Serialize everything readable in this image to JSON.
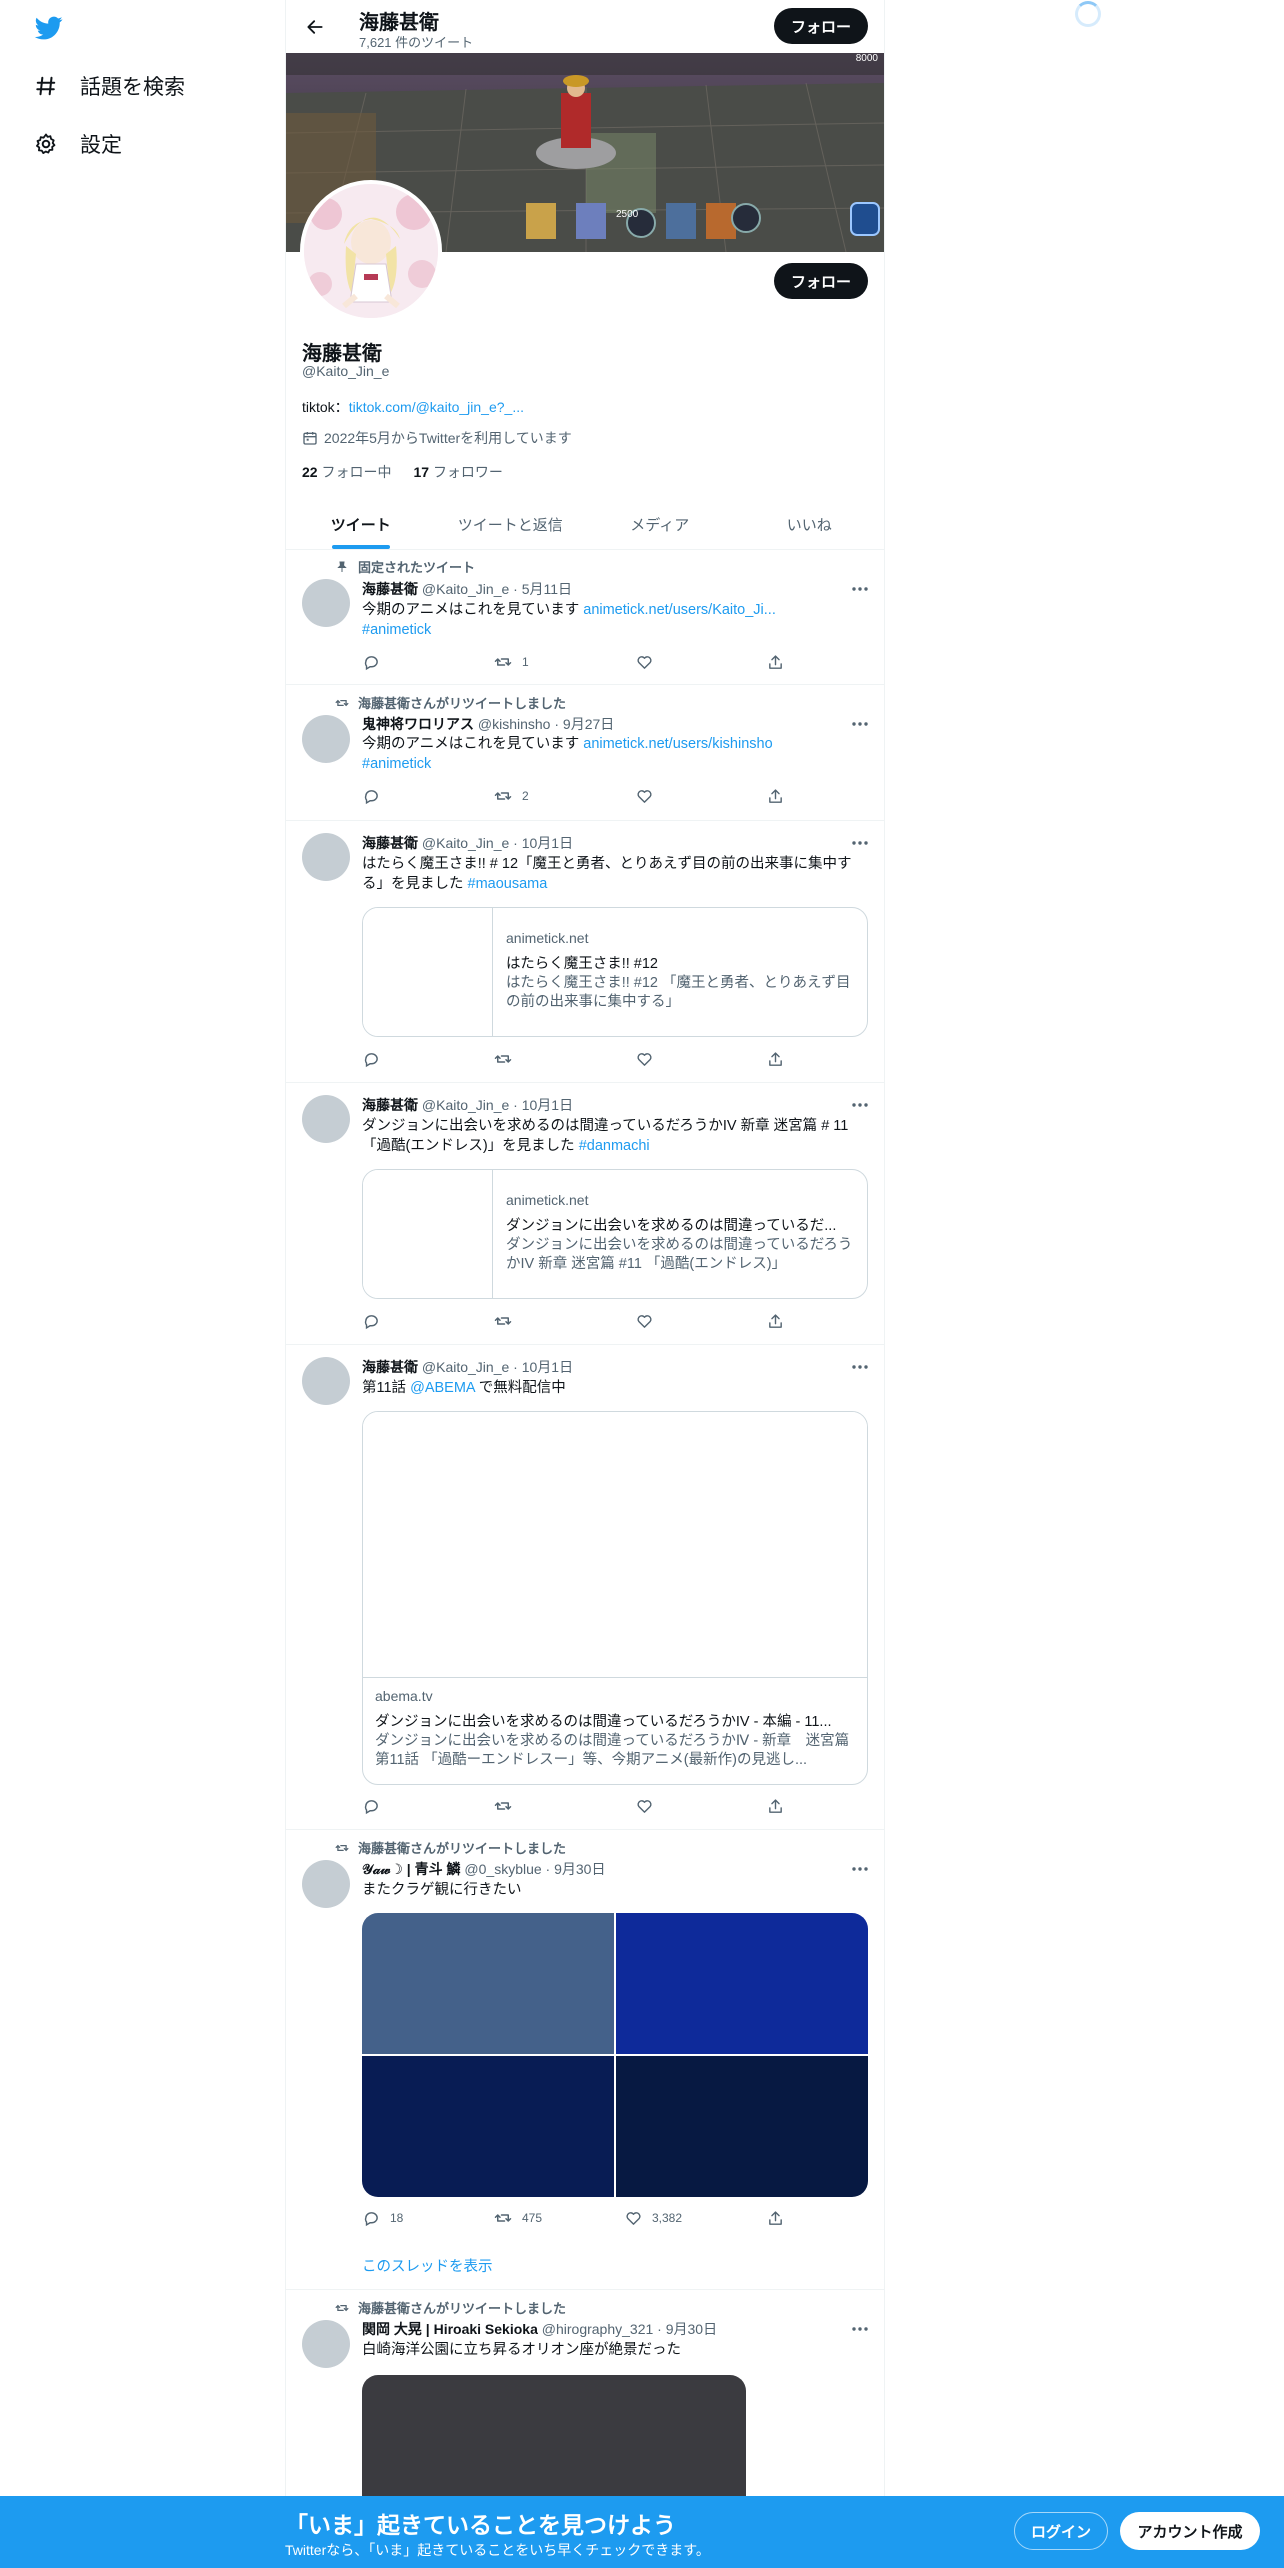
{
  "nav": {
    "explore_label": "話題を検索",
    "settings_label": "設定"
  },
  "header": {
    "name": "海藤甚衛",
    "tweet_count": "7,621 件のツイート",
    "follow_label": "フォロー"
  },
  "banner": {
    "caption": "2500",
    "corner_badge": "8000"
  },
  "profile": {
    "name": "海藤甚衛",
    "handle": "@Kaito_Jin_e",
    "bio_prefix": "tiktok：",
    "bio_link": "tiktok.com/@kaito_jin_e?_...",
    "joined": "2022年5月からTwitterを利用しています",
    "following_count": "22",
    "following_label": "フォロー中",
    "followers_count": "17",
    "followers_label": "フォロワー",
    "follow_label": "フォロー"
  },
  "tabs": [
    "ツイート",
    "ツイートと返信",
    "メディア",
    "いいね"
  ],
  "tweets": [
    {
      "social": "固定されたツイート",
      "name": "海藤甚衛",
      "meta": "@Kaito_Jin_e · 5月11日",
      "text": "今期のアニメはこれを見ています ",
      "link": "animetick.net/users/Kaito_Ji...",
      "hashtag": "#animetick",
      "retweets": "1"
    },
    {
      "social": "海藤甚衛さんがリツイートしました",
      "name": "鬼神将ワロリアス",
      "meta": "@kishinsho · 9月27日",
      "text": "今期のアニメはこれを見ています ",
      "link": "animetick.net/users/kishinsho",
      "hashtag": "#animetick",
      "retweets": "2"
    },
    {
      "name": "海藤甚衛",
      "meta": "@Kaito_Jin_e · 10月1日",
      "text": "はたらく魔王さま!! # 12「魔王と勇者、とりあえず目の前の出来事に集中する」を見ました ",
      "hashtag": "#maousama",
      "card_domain": "animetick.net",
      "card_title": "はたらく魔王さま!! #12",
      "card_desc": "はたらく魔王さま!! #12 「魔王と勇者、とりあえず目の前の出来事に集中する」"
    },
    {
      "name": "海藤甚衛",
      "meta": "@Kaito_Jin_e · 10月1日",
      "text": "ダンジョンに出会いを求めるのは間違っているだろうかIV 新章 迷宮篇 # 11「過酷(エンドレス)」を見ました ",
      "hashtag": "#danmachi",
      "card_domain": "animetick.net",
      "card_title": "ダンジョンに出会いを求めるのは間違っているだ...",
      "card_desc": "ダンジョンに出会いを求めるのは間違っているだろうかIV 新章 迷宮篇 #11 「過酷(エンドレス)」"
    },
    {
      "name": "海藤甚衛",
      "meta": "@Kaito_Jin_e · 10月1日",
      "text_prefix": "第11話 ",
      "mention": "@ABEMA",
      "text_suffix": " で無料配信中",
      "card_domain": "abema.tv",
      "card_title": "ダンジョンに出会いを求めるのは間違っているだろうかIV - 本編 - 11...",
      "card_desc": "ダンジョンに出会いを求めるのは間違っているだろうかⅣ - 新章　迷宮篇　第11話 「過酷ーエンドレスー」等、今期アニメ(最新作)の見逃し..."
    },
    {
      "social": "海藤甚衛さんがリツイートしました",
      "name": "𝒴𝒶𝓌☽ | 青斗 鱗",
      "meta": "@0_skyblue · 9月30日",
      "text": "またクラゲ観に行きたい",
      "replies": "18",
      "retweets": "475",
      "likes": "3,382",
      "thread_link": "このスレッドを表示",
      "photo_colors": [
        "#44618a",
        "#0e2a9a",
        "#081c54",
        "#071942"
      ]
    },
    {
      "social": "海藤甚衛さんがリツイートしました",
      "name": "関岡 大晃 | Hiroaki Sekioka",
      "meta": "@hirography_321 · 9月30日",
      "text": "白崎海洋公園に立ち昇るオリオン座が絶景だった"
    }
  ],
  "bottom_banner": {
    "title": "「いま」起きていることを見つけよう",
    "subtitle": "Twitterなら、「いま」起きていることをいち早くチェックできます。",
    "login_label": "ログイン",
    "signup_label": "アカウント作成"
  },
  "colors": {
    "accent": "#1d9bf0",
    "text": "#0f1419",
    "muted": "#536471",
    "border": "#eff3f4"
  }
}
